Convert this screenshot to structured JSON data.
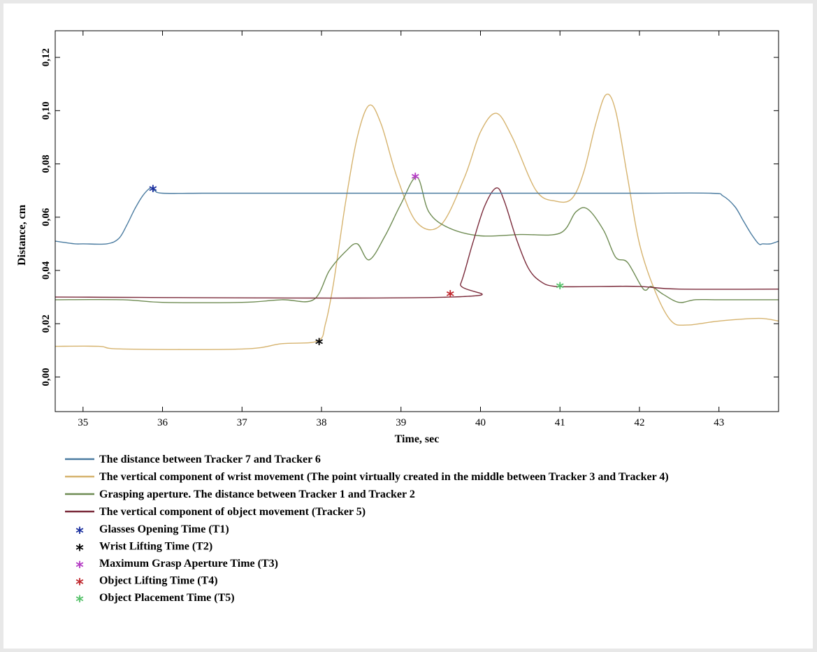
{
  "chart_data": {
    "type": "line",
    "xlabel": "Time, sec",
    "ylabel": "Distance, cm",
    "xlim": [
      34.65,
      43.75
    ],
    "ylim": [
      -0.013,
      0.13
    ],
    "xticks": [
      "35",
      "36",
      "37",
      "38",
      "39",
      "40",
      "41",
      "42",
      "43"
    ],
    "yticks": [
      "0,00",
      "0,02",
      "0,04",
      "0,06",
      "0,08",
      "0,10",
      "0,12"
    ],
    "grid": false,
    "legend_position": "below",
    "series": [
      {
        "name": "The distance between Tracker 7 and Tracker 6",
        "color": "#4a7ba0",
        "x": [
          34.65,
          34.9,
          35.0,
          35.3,
          35.45,
          35.55,
          35.65,
          35.75,
          35.85,
          35.9,
          36.0,
          36.5,
          37.0,
          38.0,
          39.0,
          40.0,
          41.0,
          42.0,
          42.9,
          43.05,
          43.2,
          43.3,
          43.4,
          43.5,
          43.55,
          43.65,
          43.75
        ],
        "y": [
          0.051,
          0.05,
          0.05,
          0.05,
          0.052,
          0.057,
          0.063,
          0.068,
          0.071,
          0.07,
          0.069,
          0.069,
          0.069,
          0.069,
          0.069,
          0.069,
          0.069,
          0.069,
          0.069,
          0.068,
          0.064,
          0.059,
          0.054,
          0.05,
          0.05,
          0.05,
          0.051
        ]
      },
      {
        "name": "The vertical component of wrist movement (The point virtually created in the middle between Tracker 3 and Tracker 4)",
        "color": "#d6b36e",
        "x": [
          34.65,
          35.2,
          35.5,
          37.0,
          37.5,
          37.95,
          38.05,
          38.15,
          38.3,
          38.45,
          38.6,
          38.75,
          38.95,
          39.2,
          39.5,
          39.8,
          40.0,
          40.2,
          40.4,
          40.7,
          40.95,
          41.15,
          41.3,
          41.45,
          41.58,
          41.7,
          41.85,
          42.0,
          42.2,
          42.4,
          42.6,
          43.0,
          43.5,
          43.75
        ],
        "y": [
          0.0115,
          0.0115,
          0.0105,
          0.0105,
          0.0125,
          0.0135,
          0.02,
          0.035,
          0.065,
          0.09,
          0.102,
          0.095,
          0.075,
          0.058,
          0.057,
          0.075,
          0.092,
          0.099,
          0.09,
          0.07,
          0.066,
          0.067,
          0.077,
          0.095,
          0.106,
          0.1,
          0.075,
          0.05,
          0.032,
          0.021,
          0.0195,
          0.021,
          0.022,
          0.021
        ]
      },
      {
        "name": "Grasping aperture. The distance between Tracker 1 and Tracker 2",
        "color": "#6e8b52",
        "x": [
          34.65,
          35.5,
          36.0,
          37.0,
          37.5,
          37.9,
          38.1,
          38.3,
          38.45,
          38.6,
          38.8,
          39.0,
          39.2,
          39.35,
          39.6,
          40.0,
          40.5,
          41.0,
          41.2,
          41.35,
          41.55,
          41.7,
          41.85,
          42.05,
          42.15,
          42.3,
          42.5,
          42.7,
          43.0,
          43.75
        ],
        "y": [
          0.029,
          0.029,
          0.028,
          0.028,
          0.029,
          0.029,
          0.04,
          0.047,
          0.05,
          0.044,
          0.053,
          0.065,
          0.075,
          0.062,
          0.056,
          0.053,
          0.0535,
          0.054,
          0.062,
          0.063,
          0.055,
          0.045,
          0.043,
          0.033,
          0.034,
          0.031,
          0.028,
          0.029,
          0.029,
          0.029
        ]
      },
      {
        "name": "The vertical component of object movement (Tracker 5)",
        "color": "#7a2a3a",
        "x": [
          34.65,
          39.62,
          39.75,
          39.9,
          40.05,
          40.2,
          40.3,
          40.45,
          40.6,
          40.75,
          40.95,
          41.5,
          42.0,
          42.5,
          43.75
        ],
        "y": [
          0.03,
          0.03,
          0.035,
          0.05,
          0.064,
          0.071,
          0.066,
          0.052,
          0.041,
          0.036,
          0.034,
          0.034,
          0.034,
          0.033,
          0.033
        ]
      }
    ],
    "markers": [
      {
        "name": "Glasses Opening Time (T1)",
        "color": "#1a2f9e",
        "x": 35.88,
        "y": 0.0705
      },
      {
        "name": "Wrist Lifting Time (T2)",
        "color": "#000000",
        "x": 37.97,
        "y": 0.013
      },
      {
        "name": "Maximum Grasp Aperture Time (T3)",
        "color": "#b43cc4",
        "x": 39.18,
        "y": 0.075
      },
      {
        "name": "Object Lifting Time (T4)",
        "color": "#c0272d",
        "x": 39.62,
        "y": 0.031
      },
      {
        "name": "Object Placement Time (T5)",
        "color": "#56c26a",
        "x": 41.0,
        "y": 0.034
      }
    ]
  }
}
